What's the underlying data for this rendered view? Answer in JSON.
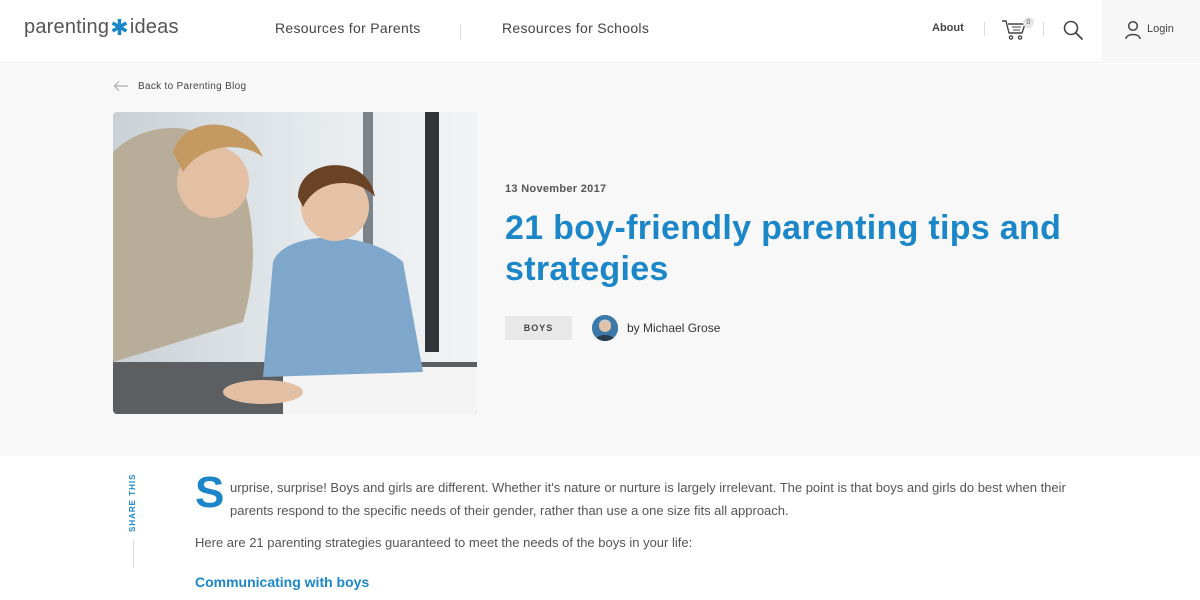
{
  "header": {
    "logo_left": "parenting",
    "logo_right": "ideas",
    "nav": [
      {
        "label": "Resources for Parents"
      },
      {
        "label": "Resources for Schools"
      }
    ],
    "about": "About",
    "cart_count": "0",
    "login": "Login"
  },
  "hero": {
    "back_link": "Back to Parenting Blog",
    "date": "13 November 2017",
    "title": "21 boy-friendly parenting tips and strategies",
    "tag": "BOYS",
    "author": "by Michael Grose"
  },
  "article": {
    "share": "SHARE THIS",
    "dropcap": "S",
    "intro": "urprise, surprise! Boys and girls are different. Whether it's nature or nurture is largely irrelevant. The point is that boys and girls do best when their parents respond to the specific needs of their gender, rather than use a one size fits all approach.",
    "lead": "Here are 21 parenting strategies guaranteed to meet the needs of the boys in your life:",
    "subheading": "Communicating with boys"
  },
  "colors": {
    "accent": "#1b86c8",
    "hero_bg": "#f8f8f8"
  },
  "icons": [
    "cart-icon",
    "search-icon",
    "user-icon",
    "arrow-left-icon"
  ]
}
